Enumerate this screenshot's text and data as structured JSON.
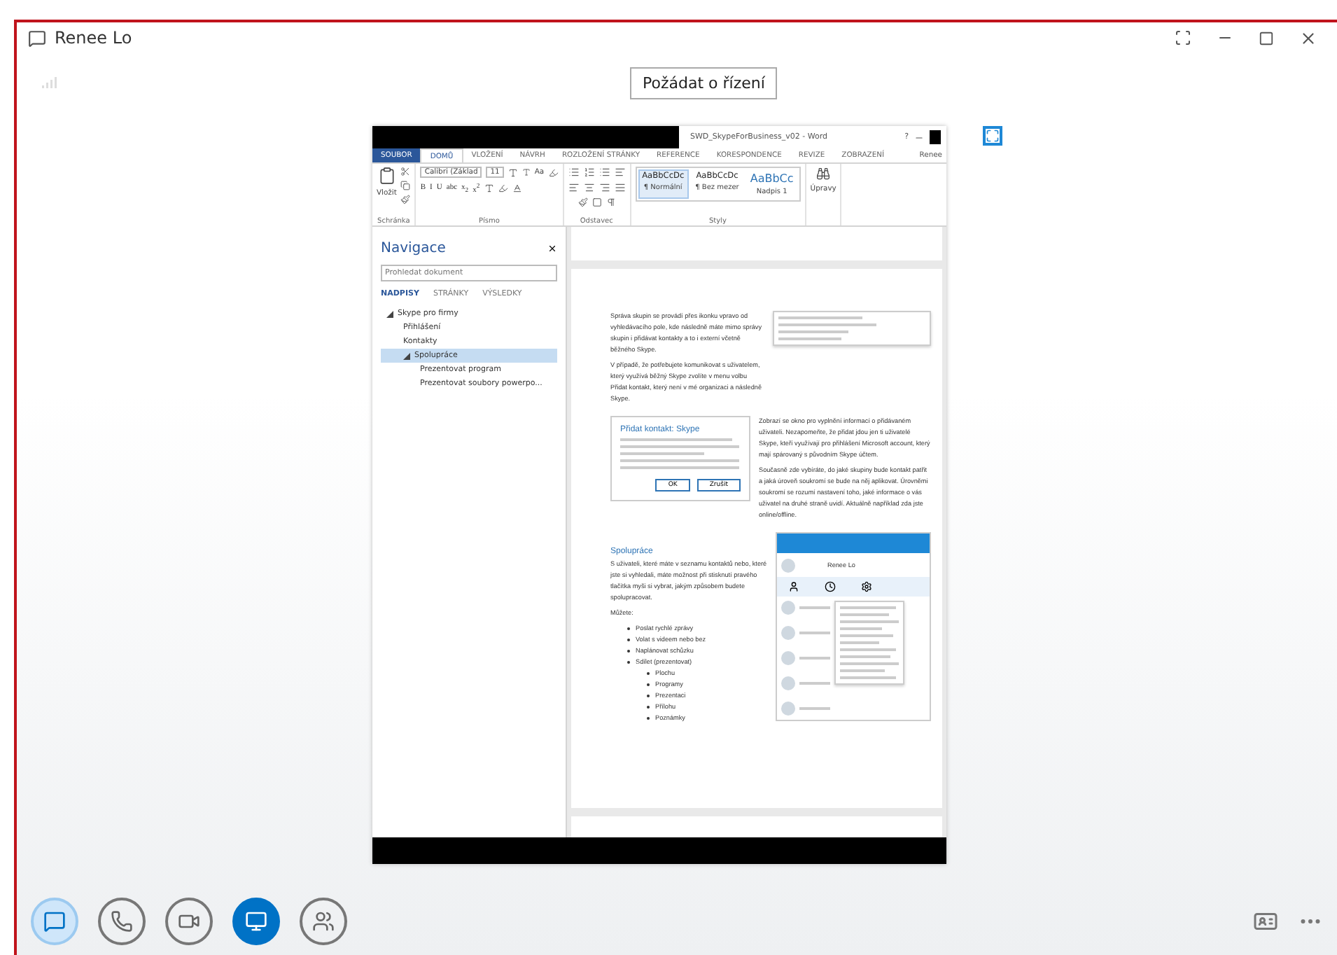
{
  "window": {
    "title": "Renee Lo"
  },
  "request_control_button": "Požádat o řízení",
  "word": {
    "title": "SWD_SkypeForBusiness_v02 - Word",
    "help": "?",
    "user": "Renee",
    "tabs": [
      {
        "label": "SOUBOR",
        "kind": "file",
        "selected": false
      },
      {
        "label": "DOMŮ",
        "kind": "tab",
        "selected": true
      },
      {
        "label": "VLOŽENÍ",
        "kind": "tab",
        "selected": false
      },
      {
        "label": "NÁVRH",
        "kind": "tab",
        "selected": false
      },
      {
        "label": "ROZLOŽENÍ STRÁNKY",
        "kind": "tab",
        "selected": false
      },
      {
        "label": "REFERENCE",
        "kind": "tab",
        "selected": false
      },
      {
        "label": "KORESPONDENCE",
        "kind": "tab",
        "selected": false
      },
      {
        "label": "REVIZE",
        "kind": "tab",
        "selected": false
      },
      {
        "label": "ZOBRAZENÍ",
        "kind": "tab",
        "selected": false
      }
    ],
    "ribbon": {
      "paste": "Vložit",
      "font": "Calibri (Základ",
      "size": "11",
      "case": "Aa",
      "format_buttons": [
        "B",
        "I",
        "U",
        "abc",
        "x$_{2}$",
        "x$^{2}$"
      ],
      "styles": [
        {
          "sample": "AaBbCcDc",
          "name": "¶ Normální",
          "selected": true
        },
        {
          "sample": "AaBbCcDc",
          "name": "¶ Bez mezer",
          "selected": false
        },
        {
          "sample": "AaBbCc",
          "name": "Nadpis 1",
          "selected": false
        }
      ],
      "editing": "Úpravy",
      "groups": [
        "Schránka",
        "Písmo",
        "Odstavec",
        "Styly"
      ]
    },
    "navigation": {
      "title": "Navigace",
      "search_placeholder": "Prohledat dokument",
      "tabs": [
        {
          "label": "NADPISY",
          "selected": true
        },
        {
          "label": "STRÁNKY",
          "selected": false
        },
        {
          "label": "VÝSLEDKY",
          "selected": false
        }
      ],
      "tree": [
        {
          "label": "Skype pro firmy",
          "expanded": true,
          "selected": false,
          "children": [
            {
              "label": "Přihlášení",
              "selected": false
            },
            {
              "label": "Kontakty",
              "selected": false
            },
            {
              "label": "Spolupráce",
              "expanded": true,
              "selected": true,
              "children": [
                {
                  "label": "Prezentovat program",
                  "selected": false
                },
                {
                  "label": "Prezentovat soubory powerpo...",
                  "selected": false
                }
              ]
            }
          ]
        }
      ]
    },
    "document": {
      "paragraph_1": "Správa skupin se provádí přes ikonku vpravo od vyhledávacího pole, kde následně máte mimo správy skupin i přidávat kontakty a to i externí včetně běžného Skype.",
      "paragraph_2": "V případě, že potřebujete komunikovat s uživatelem, který využívá běžný Skype zvolíte v menu volbu Přidat kontakt, který není v mé organizaci a následně Skype.",
      "paragraph_3": "Zobrazí se okno pro vyplnění informací o přidávaném uživateli. Nezapomeňte, že přidat jdou jen ti uživatelé Skype, kteří využívají pro přihlášení Microsoft account, který mají spárovaný s původním Skype účtem.",
      "paragraph_4": "Současně zde vybíráte, do jaké skupiny bude kontakt patřit a jaká úroveň soukromí se bude na něj aplikovat. Úrovněmi soukromí se rozumí nastavení toho, jaké informace o vás uživatel na druhé straně uvidí. Aktuálně například zda jste online/offline.",
      "dialog": {
        "title": "Přidat kontakt: Skype",
        "ok": "OK",
        "cancel": "Zrušit"
      },
      "heading": "Spolupráce",
      "paragraph_5": "S uživateli, které máte v seznamu kontaktů nebo, které jste si vyhledali, máte možnost při stisknutí pravého tlačítka myši si vybrat, jakým způsobem budete spolupracovat.",
      "list_intro": "Můžete:",
      "bullets": [
        {
          "label": "Poslat rychlé zprávy"
        },
        {
          "label": "Volat s videem nebo bez"
        },
        {
          "label": "Naplánovat schůzku"
        },
        {
          "label": "Sdílet (prezentovat)",
          "children": [
            {
              "label": "Plochu"
            },
            {
              "label": "Programy"
            },
            {
              "label": "Prezentaci"
            },
            {
              "label": "Přílohu"
            },
            {
              "label": "Poznámky"
            }
          ]
        }
      ],
      "client": {
        "name": "Renee Lo"
      }
    }
  },
  "toolbar": [
    {
      "kind": "chat",
      "active": true,
      "selected": false
    },
    {
      "kind": "call",
      "active": false,
      "selected": false
    },
    {
      "kind": "video",
      "active": false,
      "selected": false
    },
    {
      "kind": "share",
      "active": false,
      "selected": true
    },
    {
      "kind": "people",
      "active": false,
      "selected": false
    }
  ]
}
